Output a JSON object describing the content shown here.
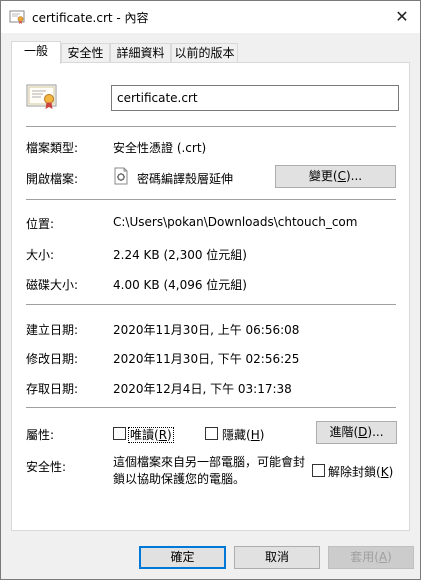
{
  "window": {
    "title": "certificate.crt - 內容",
    "close_glyph": "✕"
  },
  "tabs": [
    {
      "label": "一般"
    },
    {
      "label": "安全性"
    },
    {
      "label": "詳細資料"
    },
    {
      "label": "以前的版本"
    }
  ],
  "file": {
    "name": "certificate.crt"
  },
  "type": {
    "label": "檔案類型:",
    "value": "安全性憑證 (.crt)"
  },
  "opens_with": {
    "label": "開啟檔案:",
    "app": "密碼編譯殼層延伸",
    "change_prefix": "變更(",
    "change_key": "C",
    "change_suffix": ")..."
  },
  "location": {
    "label": "位置:",
    "value": "C:\\Users\\pokan\\Downloads\\chtouch_com"
  },
  "size": {
    "label": "大小:",
    "value": "2.24 KB (2,300 位元組)"
  },
  "size_on_disk": {
    "label": "磁碟大小:",
    "value": "4.00 KB (4,096 位元組)"
  },
  "created": {
    "label": "建立日期:",
    "value": "2020年11月30日, 上午 06:56:08"
  },
  "modified": {
    "label": "修改日期:",
    "value": "2020年11月30日, 下午 02:56:25"
  },
  "accessed": {
    "label": "存取日期:",
    "value": "2020年12月4日, 下午 03:17:38"
  },
  "attributes": {
    "label": "屬性:",
    "readonly_prefix": "唯讀(",
    "readonly_key": "R",
    "readonly_suffix": ")",
    "hidden_prefix": "隱藏(",
    "hidden_key": "H",
    "hidden_suffix": ")",
    "advanced_prefix": "進階(",
    "advanced_key": "D",
    "advanced_suffix": ")..."
  },
  "security": {
    "label": "安全性:",
    "text": "這個檔案來自另一部電腦，可能會封鎖以協助保護您的電腦。",
    "unblock_prefix": "解除封鎖(",
    "unblock_key": "K",
    "unblock_suffix": ")"
  },
  "buttons": {
    "ok": "確定",
    "cancel": "取消",
    "apply_prefix": "套用(",
    "apply_key": "A",
    "apply_suffix": ")"
  }
}
